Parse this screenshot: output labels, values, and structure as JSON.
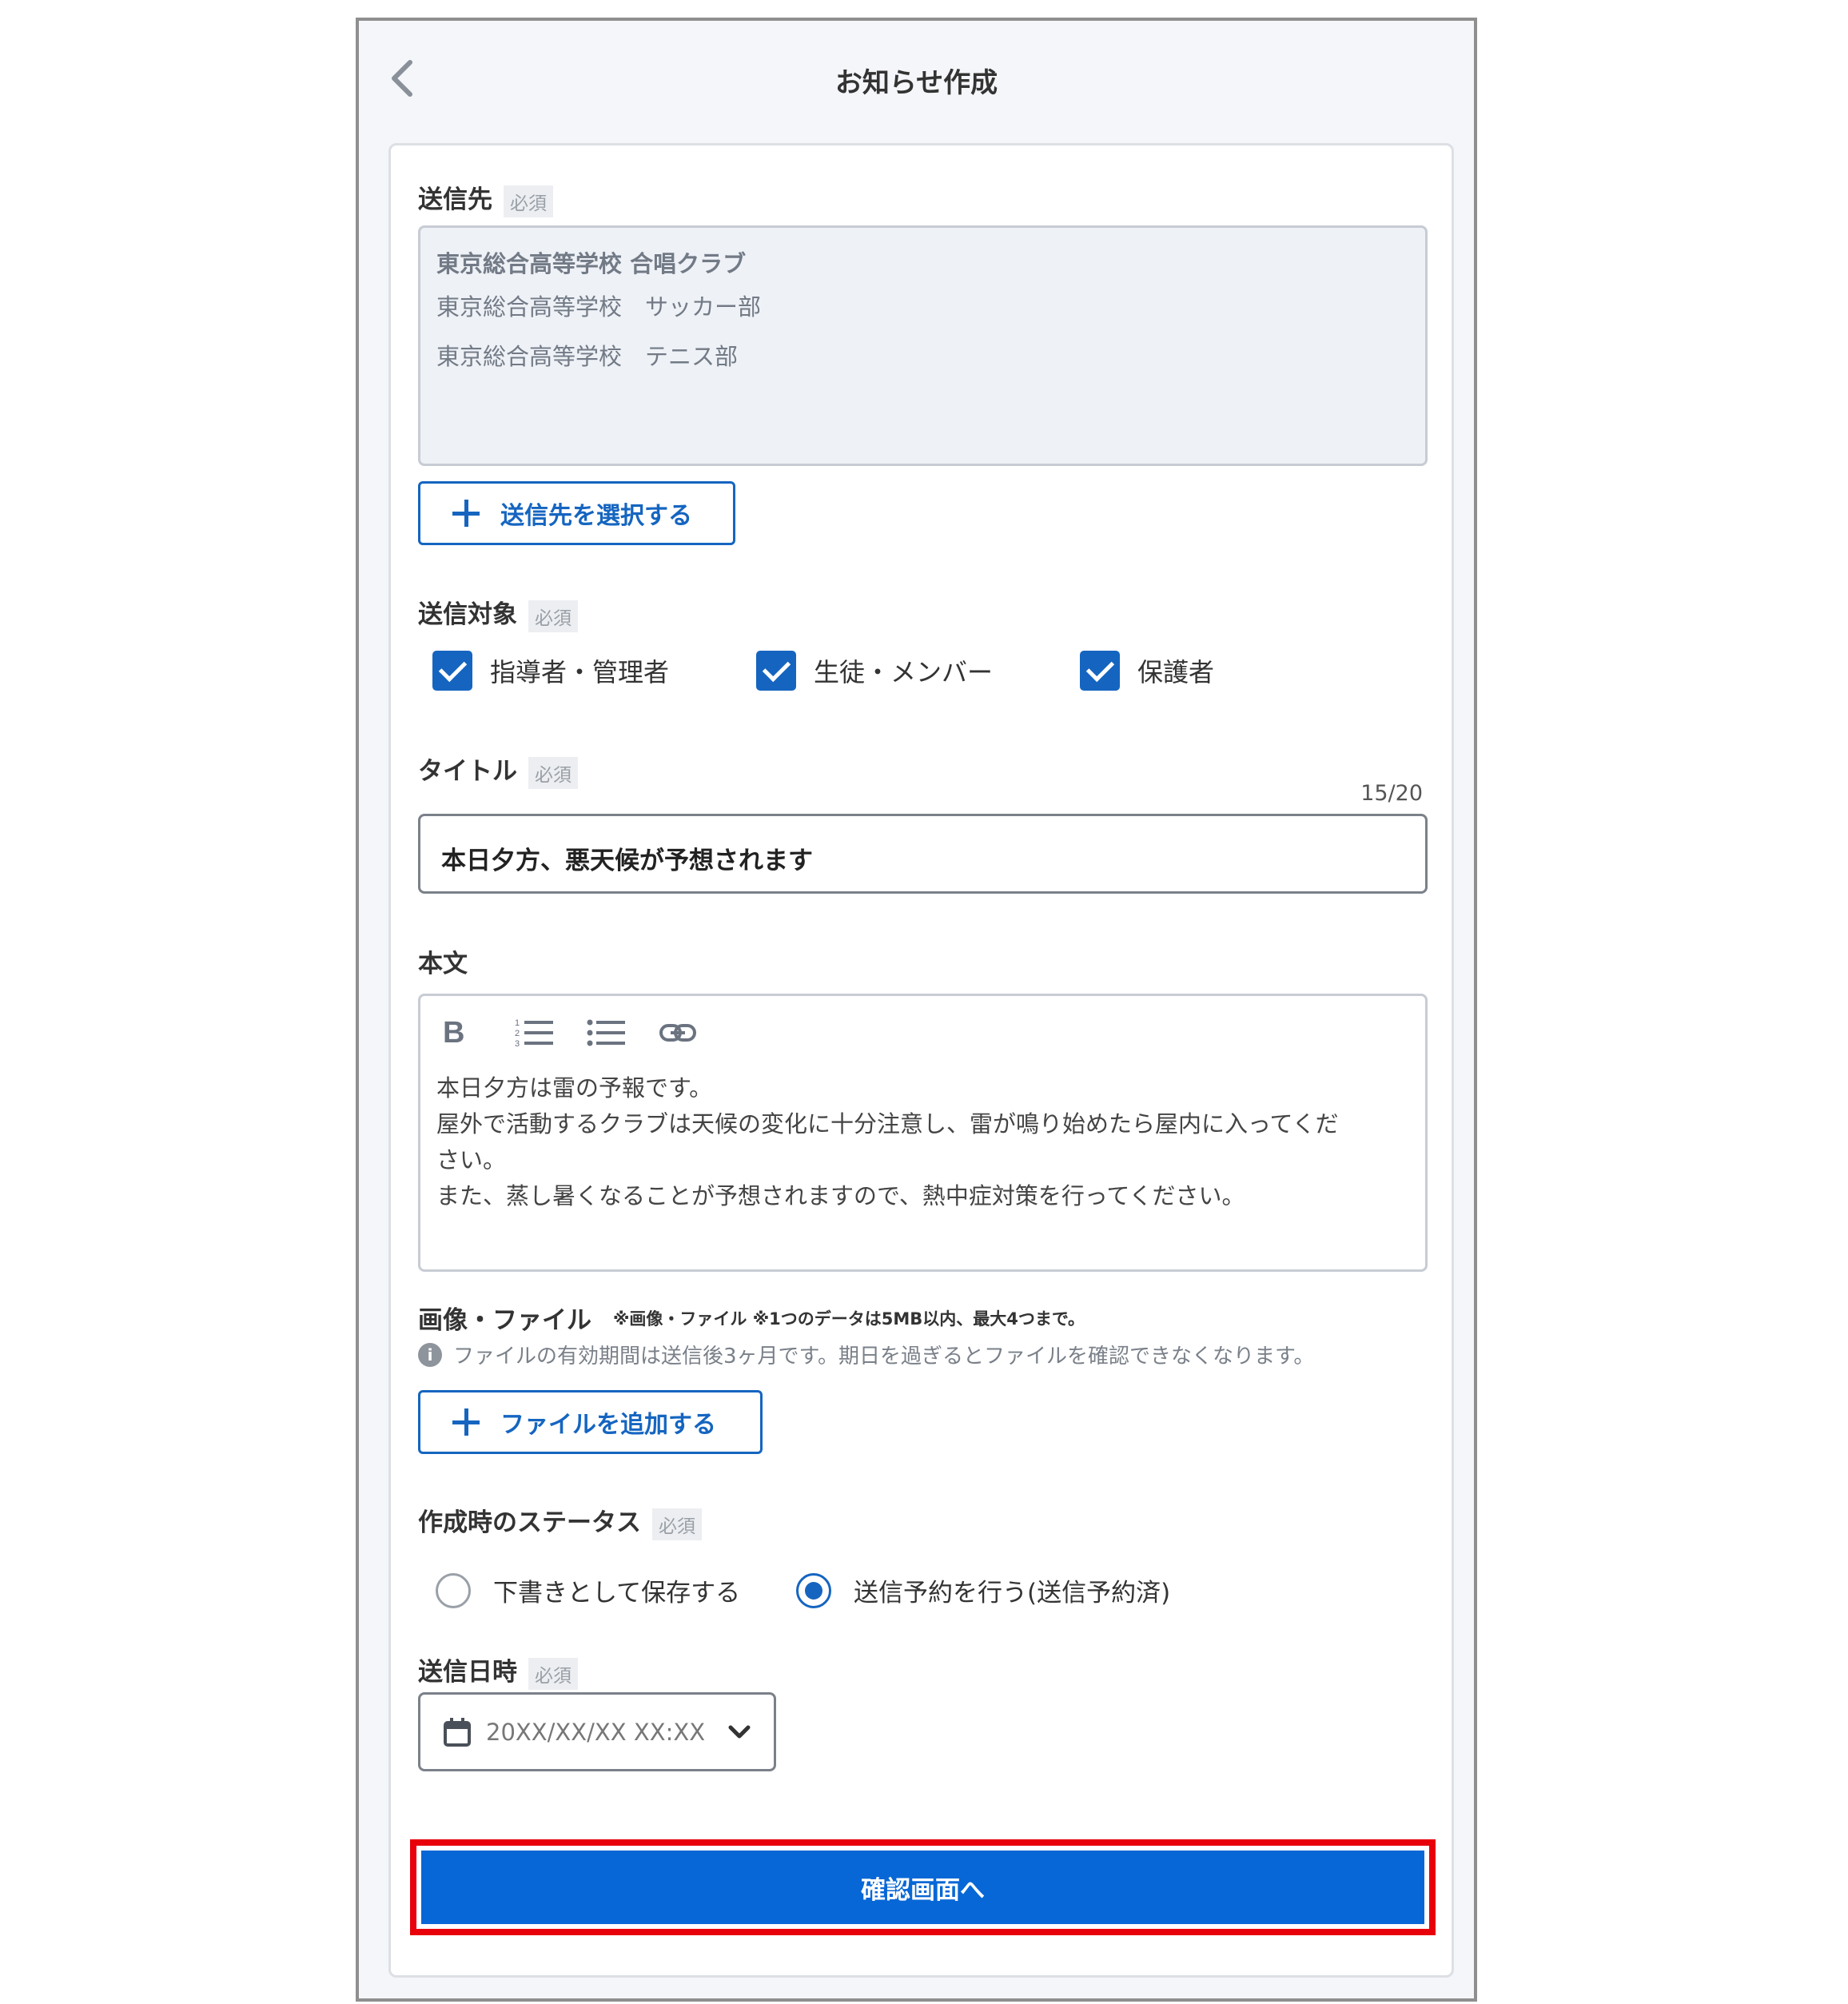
{
  "header": {
    "title": "お知らせ作成"
  },
  "required_badge": "必須",
  "destination": {
    "label": "送信先",
    "items": [
      "東京総合高等学校 合唱クラブ",
      "東京総合高等学校　サッカー部",
      "東京総合高等学校　テニス部"
    ],
    "select_button": "送信先を選択する"
  },
  "target": {
    "label": "送信対象",
    "options": [
      {
        "label": "指導者・管理者",
        "checked": true
      },
      {
        "label": "生徒・メンバー",
        "checked": true
      },
      {
        "label": "保護者",
        "checked": true
      }
    ]
  },
  "title_field": {
    "label": "タイトル",
    "counter": "15/20",
    "value": "本日夕方、悪天候が予想されます"
  },
  "body_field": {
    "label": "本文",
    "toolbar": [
      "bold-icon",
      "ordered-list-icon",
      "bullet-list-icon",
      "link-icon"
    ],
    "bold_glyph": "B",
    "lines": [
      "本日夕方は雷の予報です。",
      "屋外で活動するクラブは天候の変化に十分注意し、雷が鳴り始めたら屋内に入ってくだ",
      "さい。",
      "また、蒸し暑くなることが予想されますので、熱中症対策を行ってください。"
    ]
  },
  "files": {
    "label": "画像・ファイル",
    "note": "※画像・ファイル ※1つのデータは5MB以内、最大4つまで。",
    "info_glyph": "i",
    "info": "ファイルの有効期間は送信後3ヶ月です。期日を過ぎるとファイルを確認できなくなります。",
    "add_button": "ファイルを追加する"
  },
  "status": {
    "label": "作成時のステータス",
    "options": [
      {
        "label": "下書きとして保存する",
        "selected": false
      },
      {
        "label": "送信予約を行う(送信予約済)",
        "selected": true
      }
    ]
  },
  "send_datetime": {
    "label": "送信日時",
    "value": "20XX/XX/XX XX:XX"
  },
  "confirm_button": "確認画面へ",
  "colors": {
    "accent": "#1565c0",
    "button": "#0767d6",
    "highlight": "#e8000b"
  }
}
